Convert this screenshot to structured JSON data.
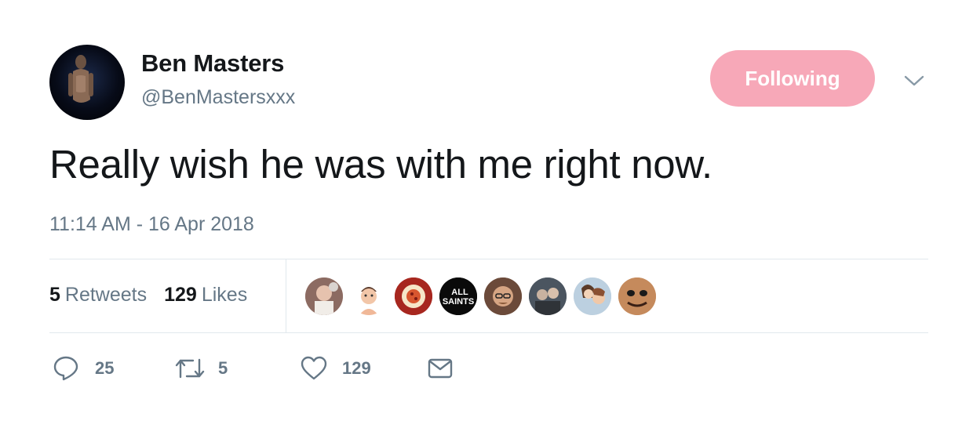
{
  "user": {
    "display_name": "Ben Masters",
    "handle": "@BenMastersxxx",
    "follow_label": "Following"
  },
  "tweet": {
    "text": "Really wish he was with me right now.",
    "timestamp": "11:14 AM - 16 Apr 2018"
  },
  "stats": {
    "retweets_count": "5",
    "retweets_label": "Retweets",
    "likes_count": "129",
    "likes_label": "Likes"
  },
  "likers": [
    {
      "icon": "avatar-selfie"
    },
    {
      "icon": "avatar-cartoon-man"
    },
    {
      "icon": "avatar-pizza-logo"
    },
    {
      "icon": "avatar-all-saints-logo",
      "text": "ALL SAINTS"
    },
    {
      "icon": "avatar-man-glasses"
    },
    {
      "icon": "avatar-group-photo"
    },
    {
      "icon": "avatar-anime"
    },
    {
      "icon": "avatar-face-closeup"
    }
  ],
  "actions": {
    "reply_count": "25",
    "retweet_count": "5",
    "like_count": "129"
  },
  "colors": {
    "follow_button": "#f7a8b8",
    "secondary_text": "#657786",
    "primary_text": "#14171a",
    "divider": "#e1e8ed"
  }
}
